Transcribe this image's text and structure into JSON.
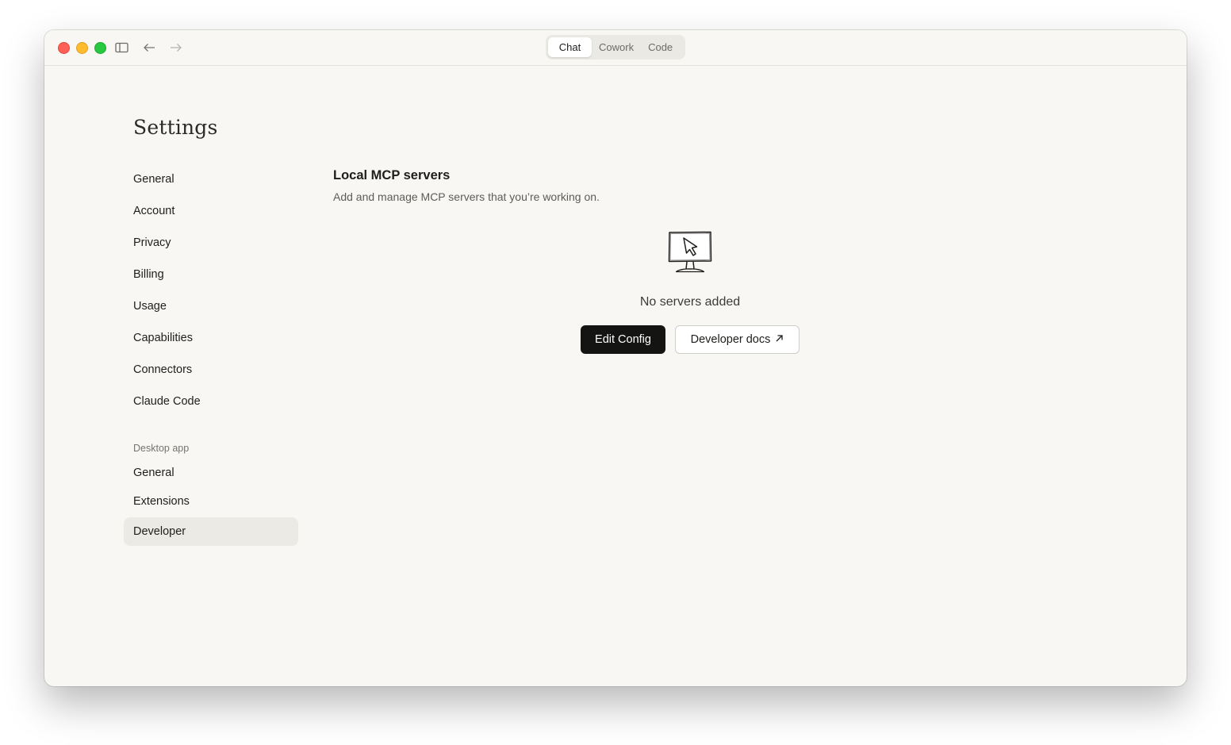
{
  "titlebar": {
    "tabs": [
      {
        "label": "Chat",
        "active": true
      },
      {
        "label": "Cowork",
        "active": false
      },
      {
        "label": "Code",
        "active": false
      }
    ],
    "icons": [
      "sidebar-toggle-icon",
      "back-arrow-icon",
      "forward-arrow-icon"
    ]
  },
  "settings": {
    "title": "Settings",
    "nav": {
      "items": [
        {
          "label": "General"
        },
        {
          "label": "Account"
        },
        {
          "label": "Privacy"
        },
        {
          "label": "Billing"
        },
        {
          "label": "Usage"
        },
        {
          "label": "Capabilities"
        },
        {
          "label": "Connectors"
        },
        {
          "label": "Claude Code"
        }
      ],
      "desktop_section_label": "Desktop app",
      "desktop_items": [
        {
          "label": "General"
        },
        {
          "label": "Extensions"
        },
        {
          "label": "Developer",
          "active": true
        }
      ]
    }
  },
  "main": {
    "title": "Local MCP servers",
    "subtitle": "Add and manage MCP servers that you’re working on.",
    "empty_state": {
      "icon": "monitor-cursor-icon",
      "text": "No servers added"
    },
    "buttons": {
      "edit_config": "Edit Config",
      "developer_docs": "Developer docs"
    }
  },
  "colors": {
    "window_bg": "#f8f7f4",
    "primary_button": "#141413",
    "active_nav_bg": "#eceae4"
  }
}
